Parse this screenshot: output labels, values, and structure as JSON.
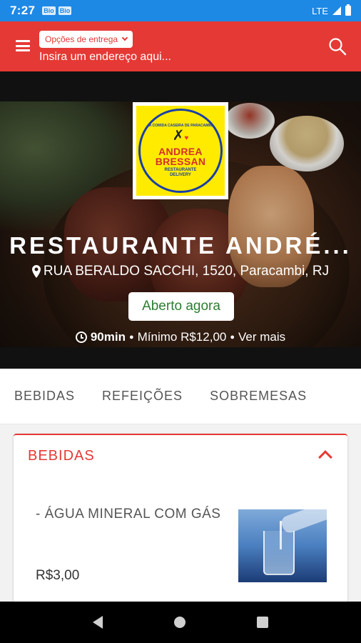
{
  "status_bar": {
    "time": "7:27",
    "notifications": [
      "Bio",
      "Bio"
    ],
    "network": "LTE"
  },
  "header": {
    "delivery_options_label": "Opções de entrega",
    "address_placeholder": "Insira um endereço aqui..."
  },
  "restaurant": {
    "name": "RESTAURANTE ANDRÉ...",
    "address": "RUA BERALDO SACCHI, 1520, Paracambi, RJ",
    "status": "Aberto agora",
    "delivery_time": "90min",
    "minimum": "Mínimo R$12,00",
    "more": "Ver mais",
    "logo": {
      "top_text": "A COMIDA CASEIRA DE PARACAMBI",
      "name_line1": "ANDREA",
      "name_line2": "BRESSAN",
      "sub_line1": "RESTAURANTE",
      "sub_line2": "DELIVERY"
    }
  },
  "tabs": [
    {
      "label": "BEBIDAS"
    },
    {
      "label": "REFEIÇÕES"
    },
    {
      "label": "SOBREMESAS"
    }
  ],
  "section": {
    "title": "BEBIDAS",
    "products": [
      {
        "name": "- ÁGUA MINERAL COM GÁS",
        "price": "R$3,00"
      }
    ]
  },
  "colors": {
    "brand_red": "#e53935",
    "status_blue": "#1e88e5",
    "open_green": "#2e7d32",
    "logo_yellow": "#ffeb00"
  },
  "icons": [
    "menu-icon",
    "chevron-down-icon",
    "search-icon",
    "location-pin-icon",
    "clock-icon",
    "chevron-up-icon",
    "back-icon",
    "home-icon",
    "recents-icon"
  ]
}
